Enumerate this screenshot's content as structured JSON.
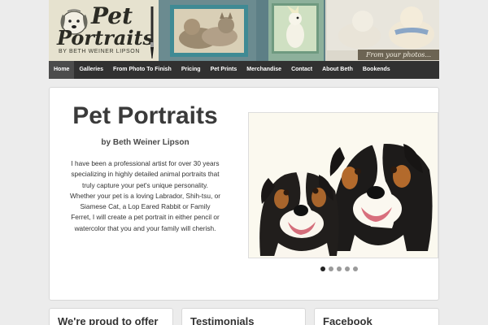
{
  "header": {
    "logo": {
      "title_line1": "Pet",
      "title_line2": "Portraits",
      "tagline": "BY BETH WEINER LIPSON"
    },
    "banner_caption": "From your photos..."
  },
  "nav": {
    "items": [
      {
        "label": "Home",
        "active": true
      },
      {
        "label": "Galleries",
        "active": false
      },
      {
        "label": "From Photo To Finish",
        "active": false
      },
      {
        "label": "Pricing",
        "active": false
      },
      {
        "label": "Pet Prints",
        "active": false
      },
      {
        "label": "Merchandise",
        "active": false
      },
      {
        "label": "Contact",
        "active": false
      },
      {
        "label": "About Beth",
        "active": false
      },
      {
        "label": "Bookends",
        "active": false
      }
    ]
  },
  "main": {
    "title": "Pet Portraits",
    "byline": "by Beth Weiner Lipson",
    "intro": "I have been a professional artist for over 30 years specializing in highly detailed animal portraits that truly capture your pet's unique personality. Whether your pet is a loving Labrador, Shih-tsu, or Siamese Cat, a Lop Eared Rabbit or Family Ferret, I will create a pet portrait in either pencil or watercolor that you and your family will cherish.",
    "slider": {
      "count": 5,
      "active_index": 0
    }
  },
  "widgets": {
    "w1_title": "We're proud to offer",
    "w2_title": "Testimonials",
    "w3_title": "Facebook"
  },
  "colors": {
    "nav_bg": "#313131",
    "nav_active": "#4c4c4c",
    "page_bg": "#ececec",
    "banner_teal": "#3f8a94"
  }
}
